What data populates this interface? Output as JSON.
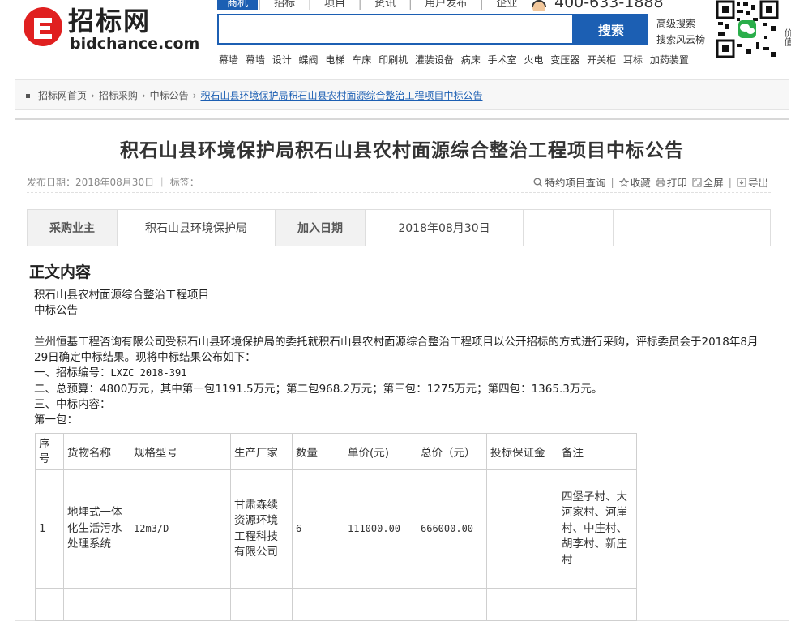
{
  "header": {
    "logo_cn": "招标网",
    "logo_en": "bidchance.com",
    "nav_tabs": [
      "商机",
      "招标",
      "项目",
      "资讯",
      "用户发布",
      "企业"
    ],
    "hotline": "400-633-1888",
    "search_button": "搜索",
    "advanced_search": "高级搜索",
    "fengyun_search": "搜索风云榜",
    "edge_text": "价值"
  },
  "keywords": [
    "幕墙",
    "幕墙",
    "设计",
    "蝶阀",
    "电梯",
    "车床",
    "印刷机",
    "灌装设备",
    "病床",
    "手术室",
    "火电",
    "变压器",
    "开关柜",
    "耳标",
    "加药装置"
  ],
  "breadcrumb": {
    "items": [
      "招标网首页",
      "招标采购",
      "中标公告"
    ],
    "current": "积石山县环境保护局积石山县农村面源综合整治工程项目中标公告"
  },
  "article": {
    "title": "积石山县环境保护局积石山县农村面源综合整治工程项目中标公告",
    "meta": "发布日期：2018年08月30日 ｜ 标签：",
    "tools": {
      "special_query": "特约项目查询",
      "favorite": "收藏",
      "print": "打印",
      "fullscreen": "全屏",
      "export": "导出"
    },
    "info": {
      "buyer_label": "采购业主",
      "buyer_value": "积石山县环境保护局",
      "date_label": "加入日期",
      "date_value": "2018年08月30日"
    },
    "section_title": "正文内容",
    "lines": {
      "l1": "积石山县农村面源综合整治工程项目",
      "l2": "中标公告",
      "l3": "兰州恒基工程咨询有限公司受积石山县环境保护局的委托就积石山县农村面源综合整治工程项目以公开招标的方式进行采购，评标委员会于2018年8月29日确定中标结果。现将中标结果公布如下：",
      "l4_prefix": "一、招标编号：",
      "l4_code": "LXZC 2018-391",
      "l5": "二、总预算：4800万元，其中第一包1191.5万元；第二包968.2万元；第三包：1275万元；第四包：1365.3万元。",
      "l6": "三、中标内容：",
      "l7": "第一包："
    },
    "table": {
      "headers": [
        "序号",
        "货物名称",
        "规格型号",
        "生产厂家",
        "数量",
        "单价(元)",
        "总价（元）",
        "投标保证金",
        "备注"
      ],
      "row1": {
        "index": "1",
        "name": "地埋式一体化生活污水处理系统",
        "spec": "12m3/D",
        "maker": "甘肃森续资源环境工程科技有限公司",
        "qty": "6",
        "unit_price": "111000.00",
        "total": "666000.00",
        "deposit": "",
        "remark": "四堡子村、大河家村、河崖村、中庄村、胡李村、新庄村"
      }
    }
  }
}
